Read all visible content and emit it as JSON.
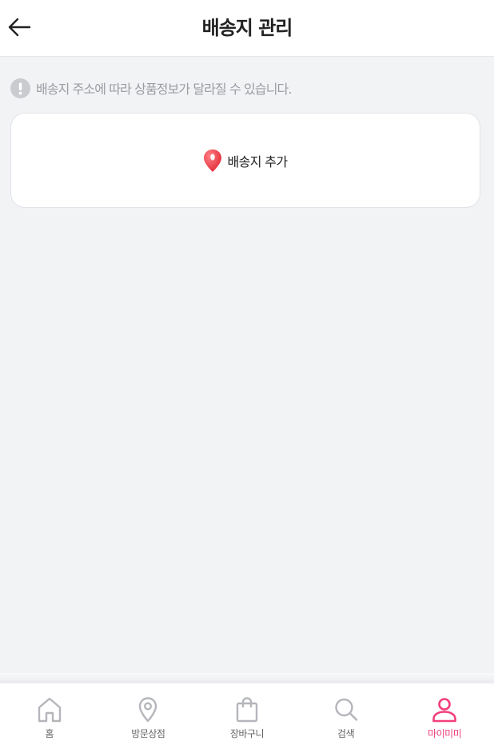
{
  "header": {
    "title": "배송지 관리",
    "back_icon": "arrow-left-icon"
  },
  "notice": {
    "icon": "exclamation-circle-icon",
    "text": "배송지 주소에 따라 상품정보가 달라질 수 있습니다."
  },
  "add_address": {
    "icon": "map-pin-icon",
    "label": "배송지 추가"
  },
  "tabbar": {
    "items": [
      {
        "label": "홈",
        "icon": "home-icon",
        "active": false
      },
      {
        "label": "방문상점",
        "icon": "location-pin-icon",
        "active": false
      },
      {
        "label": "장바구니",
        "icon": "shopping-bag-icon",
        "active": false
      },
      {
        "label": "검색",
        "icon": "search-icon",
        "active": false
      },
      {
        "label": "마이미미",
        "icon": "user-icon",
        "active": true
      }
    ]
  },
  "colors": {
    "accent": "#f23e7c",
    "pin": "#f0383f",
    "background": "#f2f3f5",
    "inactive_icon": "#b4b6bb"
  }
}
